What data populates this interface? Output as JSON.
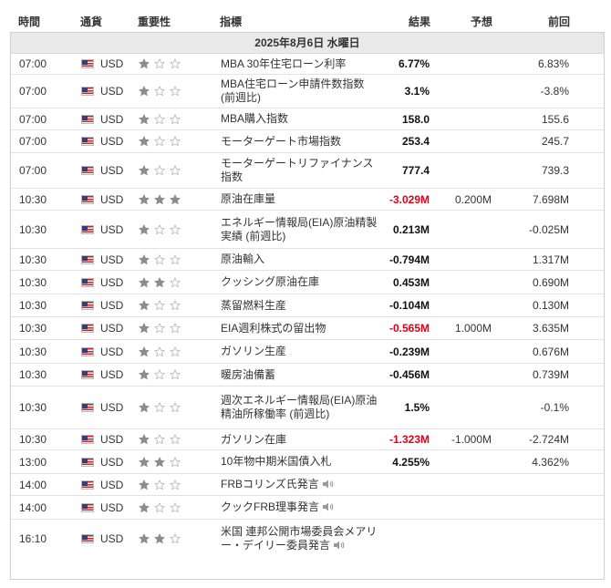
{
  "columns": {
    "time": "時間",
    "currency": "通貨",
    "importance": "重要性",
    "indicator": "指標",
    "actual": "結果",
    "forecast": "予想",
    "previous": "前回"
  },
  "date_header": "2025年8月6日 水曜日",
  "icons": {
    "flag": "us-flag-icon",
    "star": "star-icon",
    "speaker": "speaker-icon"
  },
  "colors": {
    "negative_actual": "#e0001a",
    "star_filled": "#8c8c8c",
    "star_empty": "#b5b5b5",
    "date_bar_bg": "#e9e9e9"
  },
  "rows": [
    {
      "time": "07:00",
      "currency": "USD",
      "importance": 1,
      "name": "MBA 30年住宅ローン利率",
      "actual": "6.77%",
      "actual_negative": false,
      "forecast": "",
      "previous": "6.83%",
      "speaker": false
    },
    {
      "time": "07:00",
      "currency": "USD",
      "importance": 1,
      "name": "MBA住宅ローン申請件数指数 (前週比)",
      "actual": "3.1%",
      "actual_negative": false,
      "forecast": "",
      "previous": "-3.8%",
      "speaker": false
    },
    {
      "time": "07:00",
      "currency": "USD",
      "importance": 1,
      "name": "MBA購入指数",
      "actual": "158.0",
      "actual_negative": false,
      "forecast": "",
      "previous": "155.6",
      "speaker": false
    },
    {
      "time": "07:00",
      "currency": "USD",
      "importance": 1,
      "name": "モーターゲート市場指数",
      "actual": "253.4",
      "actual_negative": false,
      "forecast": "",
      "previous": "245.7",
      "speaker": false
    },
    {
      "time": "07:00",
      "currency": "USD",
      "importance": 1,
      "name": "モーターゲートリファイナンス指数",
      "actual": "777.4",
      "actual_negative": false,
      "forecast": "",
      "previous": "739.3",
      "speaker": false
    },
    {
      "time": "10:30",
      "currency": "USD",
      "importance": 3,
      "name": "原油在庫量",
      "actual": "-3.029M",
      "actual_negative": true,
      "forecast": "0.200M",
      "previous": "7.698M",
      "speaker": false
    },
    {
      "time": "10:30",
      "currency": "USD",
      "importance": 1,
      "name": "エネルギー情報局(EIA)原油精製実績 (前週比)",
      "actual": "0.213M",
      "actual_negative": false,
      "forecast": "",
      "previous": "-0.025M",
      "speaker": false
    },
    {
      "time": "10:30",
      "currency": "USD",
      "importance": 1,
      "name": "原油輸入",
      "actual": "-0.794M",
      "actual_negative": false,
      "forecast": "",
      "previous": "1.317M",
      "speaker": false
    },
    {
      "time": "10:30",
      "currency": "USD",
      "importance": 2,
      "name": "クッシング原油在庫",
      "actual": "0.453M",
      "actual_negative": false,
      "forecast": "",
      "previous": "0.690M",
      "speaker": false
    },
    {
      "time": "10:30",
      "currency": "USD",
      "importance": 1,
      "name": "蒸留燃料生産",
      "actual": "-0.104M",
      "actual_negative": false,
      "forecast": "",
      "previous": "0.130M",
      "speaker": false
    },
    {
      "time": "10:30",
      "currency": "USD",
      "importance": 1,
      "name": "EIA週利株式の留出物",
      "actual": "-0.565M",
      "actual_negative": true,
      "forecast": "1.000M",
      "previous": "3.635M",
      "speaker": false
    },
    {
      "time": "10:30",
      "currency": "USD",
      "importance": 1,
      "name": "ガソリン生産",
      "actual": "-0.239M",
      "actual_negative": false,
      "forecast": "",
      "previous": "0.676M",
      "speaker": false
    },
    {
      "time": "10:30",
      "currency": "USD",
      "importance": 1,
      "name": "暖房油備蓄",
      "actual": "-0.456M",
      "actual_negative": false,
      "forecast": "",
      "previous": "0.739M",
      "speaker": false
    },
    {
      "time": "10:30",
      "currency": "USD",
      "importance": 1,
      "name": "週次エネルギー情報局(EIA)原油精油所稼働率 (前週比)",
      "actual": "1.5%",
      "actual_negative": false,
      "forecast": "",
      "previous": "-0.1%",
      "speaker": false
    },
    {
      "time": "10:30",
      "currency": "USD",
      "importance": 1,
      "name": "ガソリン在庫",
      "actual": "-1.323M",
      "actual_negative": true,
      "forecast": "-1.000M",
      "previous": "-2.724M",
      "speaker": false
    },
    {
      "time": "13:00",
      "currency": "USD",
      "importance": 2,
      "name": "10年物中期米国債入札",
      "actual": "4.255%",
      "actual_negative": false,
      "forecast": "",
      "previous": "4.362%",
      "speaker": false
    },
    {
      "time": "14:00",
      "currency": "USD",
      "importance": 1,
      "name": "FRBコリンズ氏発言",
      "actual": "",
      "actual_negative": false,
      "forecast": "",
      "previous": "",
      "speaker": true
    },
    {
      "time": "14:00",
      "currency": "USD",
      "importance": 1,
      "name": "クックFRB理事発言",
      "actual": "",
      "actual_negative": false,
      "forecast": "",
      "previous": "",
      "speaker": true
    },
    {
      "time": "16:10",
      "currency": "USD",
      "importance": 2,
      "name": "米国 連邦公開市場委員会メアリー・デイリー委員発言",
      "actual": "",
      "actual_negative": false,
      "forecast": "",
      "previous": "",
      "speaker": true
    }
  ]
}
